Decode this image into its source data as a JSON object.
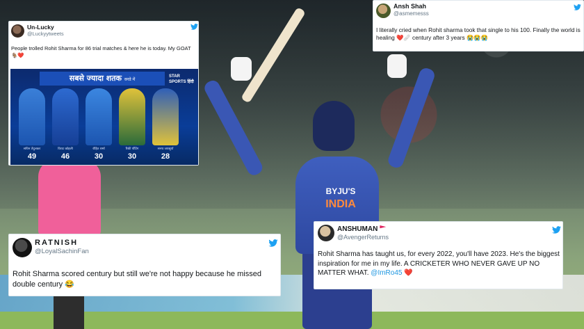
{
  "colors": {
    "twitter_blue": "#1da1f2",
    "link": "#1b95e0",
    "card_bg": "#ffffff"
  },
  "tweets": [
    {
      "name": "Un-Lucky",
      "handle": "@Luckyytweets",
      "text": "People trolled Rohit Sharma for 86 trial matches & here he is today. My GOAT 🐐❤️",
      "icon": "twitter-bird-icon",
      "media": {
        "banner": "सबसे ज्यादा शतक",
        "banner_sub": "वनडे में",
        "channel": "STAR SPORTS हिंदी",
        "players": [
          {
            "name": "सचिन तेंदुलकर",
            "score": "49"
          },
          {
            "name": "विराट कोहली",
            "score": "46"
          },
          {
            "name": "रोहित शर्मा",
            "score": "30"
          },
          {
            "name": "रिकी पोंटिंग",
            "score": "30"
          },
          {
            "name": "सनथ जयसूर्या",
            "score": "28"
          }
        ]
      }
    },
    {
      "name": "Ansh Shah",
      "handle": "@asmemesss",
      "text_before": "I literally cried when Rohit sharma took that single to his 100. Finally the world is healing ",
      "emoji": "❤️🩹",
      "text_after": " century after 3 years 😭😭😭",
      "icon": "twitter-bird-icon"
    },
    {
      "name": "RATNISH",
      "handle": "@LoyalSachinFan",
      "text": "Rohit Sharma scored century but still we're not happy because he missed double century 😂",
      "icon": "twitter-bird-icon"
    },
    {
      "name": "ANSHUMAN",
      "handle": "@AvengerReturns",
      "text_before": "Rohit Sharma has taught us, for every 2022, you'll have 2023. He's the biggest inspiration for me in my life. A CRICKETER WHO NEVER GAVE UP NO MATTER WHAT. ",
      "mention": "@ImRo45",
      "heart": " ❤️",
      "icon": "twitter-bird-icon"
    }
  ],
  "photo": {
    "jersey_brand": "BYJU'S",
    "jersey_team": "INDIA"
  }
}
